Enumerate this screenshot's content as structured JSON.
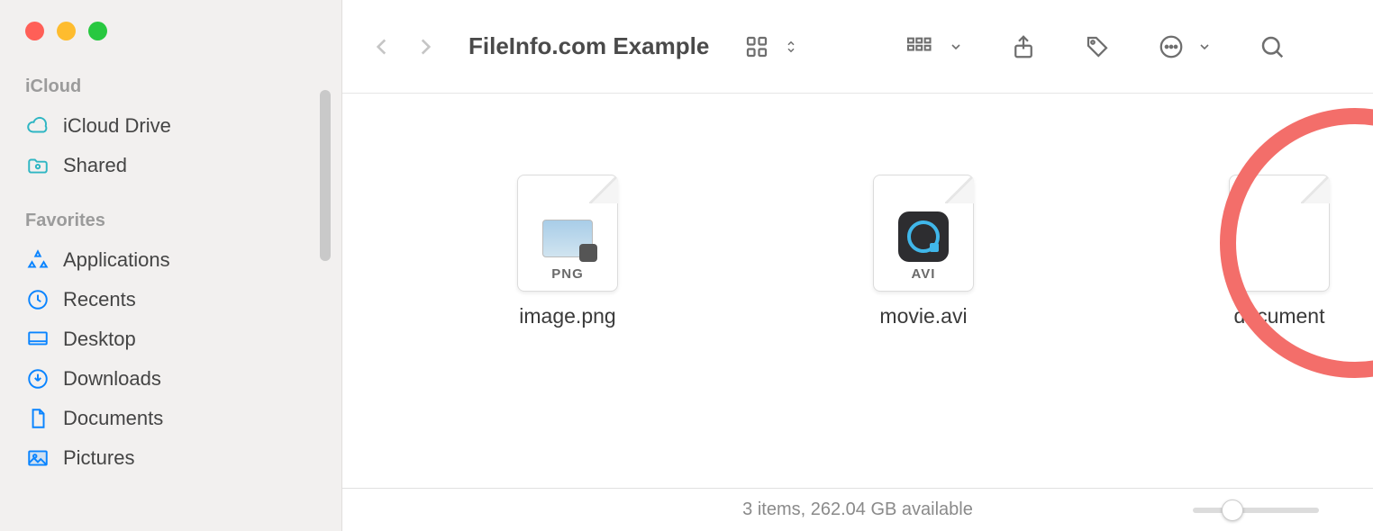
{
  "window": {
    "title": "FileInfo.com Example"
  },
  "sidebar": {
    "sections": [
      {
        "header": "iCloud",
        "items": [
          {
            "label": "iCloud Drive",
            "icon": "cloud"
          },
          {
            "label": "Shared",
            "icon": "shared-folder"
          }
        ]
      },
      {
        "header": "Favorites",
        "items": [
          {
            "label": "Applications",
            "icon": "apps"
          },
          {
            "label": "Recents",
            "icon": "clock"
          },
          {
            "label": "Desktop",
            "icon": "desktop"
          },
          {
            "label": "Downloads",
            "icon": "download"
          },
          {
            "label": "Documents",
            "icon": "document"
          },
          {
            "label": "Pictures",
            "icon": "pictures"
          }
        ]
      }
    ]
  },
  "files": [
    {
      "name": "image.png",
      "badge": "PNG",
      "kind": "png"
    },
    {
      "name": "movie.avi",
      "badge": "AVI",
      "kind": "avi"
    },
    {
      "name": "document",
      "badge": "",
      "kind": "blank"
    }
  ],
  "status": {
    "text": "3 items, 262.04 GB available"
  },
  "annotation": {
    "highlightedFile": "document"
  }
}
